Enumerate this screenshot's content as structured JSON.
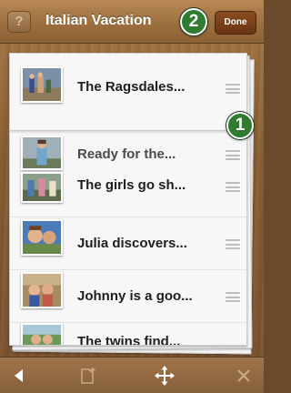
{
  "header": {
    "help_label": "?",
    "title": "Italian Vacation",
    "done_label": "Done"
  },
  "callouts": {
    "first": "1",
    "second": "2"
  },
  "entries": [
    {
      "title": "The Ragsdales..."
    },
    {
      "title": "Ready for the..."
    },
    {
      "title": "The girls go sh..."
    },
    {
      "title": "Julia discovers..."
    },
    {
      "title": "Johnny is a goo..."
    },
    {
      "title": "The twins find..."
    }
  ],
  "toolbar": {
    "back_icon": "back-arrow-icon",
    "new_page_icon": "new-page-icon",
    "move_icon": "move-arrows-icon",
    "delete_icon": "delete-x-icon"
  },
  "colors": {
    "wood": "#8a5e33",
    "done_button": "#7a3f18",
    "callout": "#2f7b2f",
    "paper": "#f7f7f7"
  }
}
